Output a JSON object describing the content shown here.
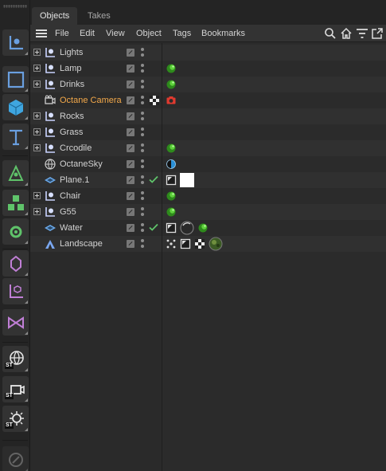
{
  "tabs": [
    {
      "label": "Objects",
      "active": true
    },
    {
      "label": "Takes",
      "active": false
    }
  ],
  "menu": {
    "items": [
      "File",
      "Edit",
      "View",
      "Object",
      "Tags",
      "Bookmarks"
    ],
    "right_icons": [
      "search-icon",
      "home-icon",
      "filter-icon",
      "expand-icon"
    ]
  },
  "palette": {
    "tools": [
      "null-object-icon",
      "cube-outline-icon",
      "cube-solid-icon",
      "text-icon",
      "spline-pen-icon",
      "cloner-icon",
      "deformer-icon",
      "capsule-icon",
      "axis-icon",
      "mograph-icon",
      "octane-sky-icon",
      "octane-camera-icon",
      "octane-light-icon",
      "lock-icon"
    ],
    "badges": [
      "ST",
      "ST",
      "ST"
    ]
  },
  "objects": [
    {
      "name": "Lights",
      "icon": "null-object-icon",
      "expandable": true,
      "check": false,
      "tags": []
    },
    {
      "name": "Lamp",
      "icon": "null-object-icon",
      "expandable": true,
      "check": false,
      "tags": [
        "green-sphere-tag"
      ]
    },
    {
      "name": "Drinks",
      "icon": "null-object-icon",
      "expandable": true,
      "check": false,
      "tags": [
        "green-sphere-tag"
      ]
    },
    {
      "name": "Octane Camera",
      "icon": "camera-icon",
      "expandable": false,
      "check": false,
      "highlight": true,
      "tags": [
        "checker-tag",
        "camera-tag"
      ]
    },
    {
      "name": "Rocks",
      "icon": "null-object-icon",
      "expandable": true,
      "check": false,
      "tags": []
    },
    {
      "name": "Grass",
      "icon": "null-object-icon",
      "expandable": true,
      "check": false,
      "tags": []
    },
    {
      "name": "Crcodile",
      "icon": "null-object-icon",
      "expandable": true,
      "check": false,
      "tags": [
        "green-sphere-tag"
      ]
    },
    {
      "name": "OctaneSky",
      "icon": "sky-icon",
      "expandable": false,
      "check": false,
      "tags": [
        "blue-half-tag"
      ]
    },
    {
      "name": "Plane.1",
      "icon": "plane-icon",
      "expandable": false,
      "check": true,
      "tags": [
        "texture-tag",
        "white-material-tag"
      ]
    },
    {
      "name": "Chair",
      "icon": "null-object-icon",
      "expandable": true,
      "check": false,
      "tags": [
        "green-sphere-tag"
      ]
    },
    {
      "name": "G55",
      "icon": "null-object-icon",
      "expandable": true,
      "check": false,
      "tags": [
        "green-sphere-tag"
      ]
    },
    {
      "name": "Water",
      "icon": "plane-icon",
      "expandable": false,
      "check": true,
      "tags": [
        "texture-tag",
        "dark-sphere-tag",
        "green-sphere-tag"
      ]
    },
    {
      "name": "Landscape",
      "icon": "landscape-icon",
      "expandable": false,
      "check": false,
      "tags": [
        "scatter-tag",
        "texture-tag",
        "checker-tag",
        "moss-sphere-tag"
      ]
    }
  ],
  "colors": {
    "accent_orange": "#f2a84a",
    "check_green": "#5fc36a",
    "material_green": "#3fb82a",
    "sky_blue": "#2a8fd6",
    "camera_red": "#e03a2f",
    "icon_blue": "#6a9fe0"
  }
}
